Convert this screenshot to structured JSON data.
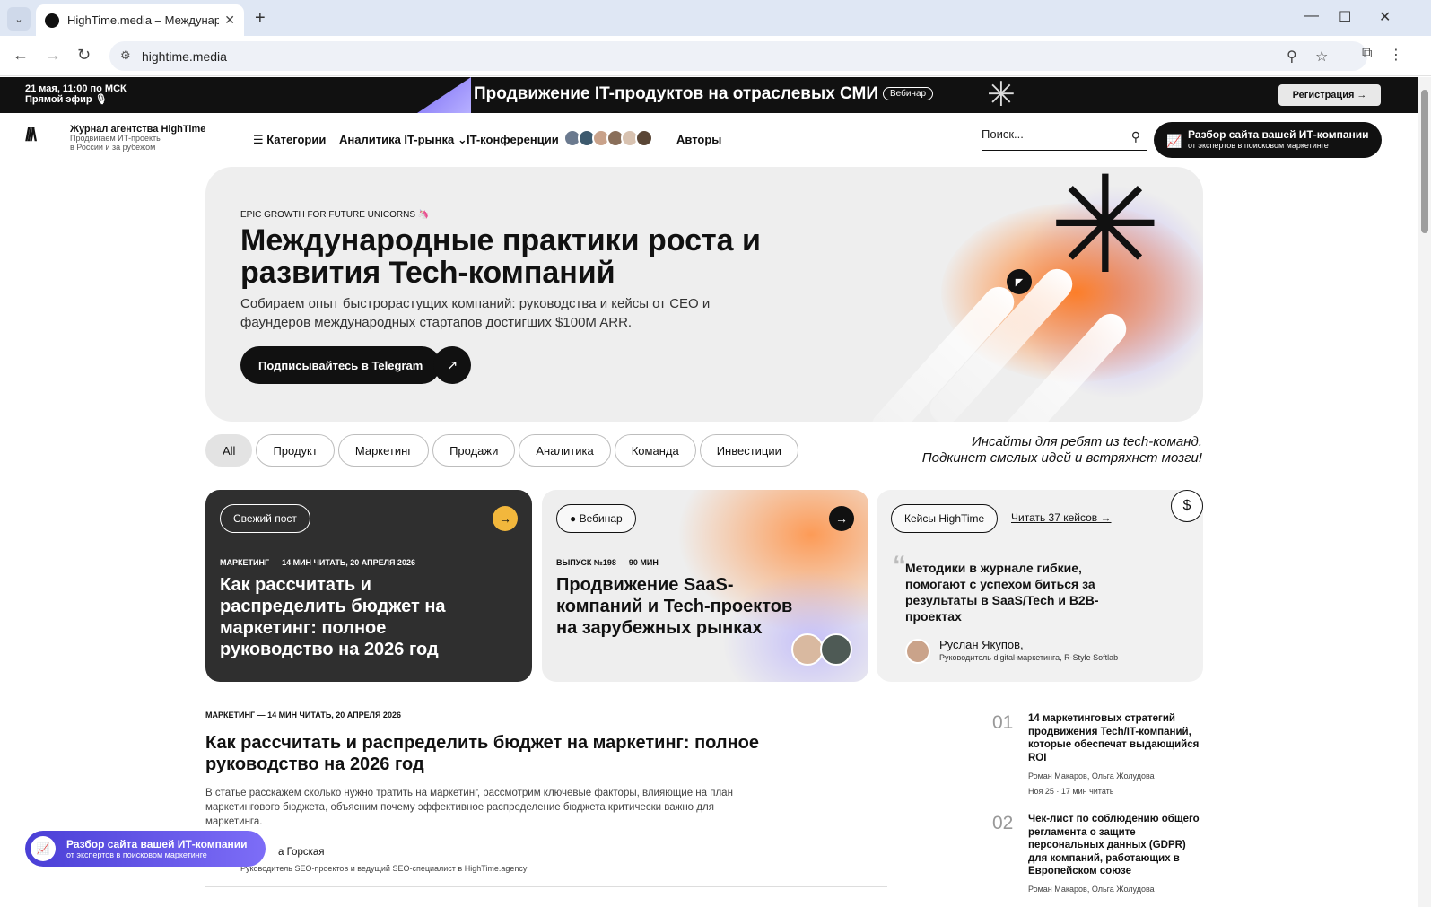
{
  "browser": {
    "tab_title": "HighTime.media – Междунаро",
    "tab_close": "✕",
    "new_tab": "+",
    "url": "hightime.media",
    "window_minimize": "—",
    "window_maximize": "☐",
    "window_close": "✕"
  },
  "promo_bar": {
    "date": "21 мая, 11:00 по МСК",
    "status": "Прямой эфир 🎙",
    "title": "Продвижение IT-продуктов на отраслевых СМИ",
    "badge": "Вебинар",
    "button": "Регистрация →"
  },
  "header": {
    "brand_title": "Журнал агентства HighTime",
    "brand_sub1": "Продвигаем ИТ-проекты",
    "brand_sub2": "в России и за рубежом",
    "menu": [
      "Категории",
      "Аналитика IT-рынка ⌄",
      "IT-конференции ⌄",
      "Авторы"
    ],
    "search_placeholder": "Поиск...",
    "cta_title": "Разбор сайта вашей ИТ-компании",
    "cta_sub": "от экспертов в поисковом маркетинге"
  },
  "hero": {
    "kicker": "EPIC GROWTH FOR FUTURE UNICORNS 🦄",
    "title": "Международные практики роста и развития Tech-компаний",
    "lead": "Собираем опыт быстрорастущих компаний: руководства и кейсы от CEO и фаундеров международных стартапов достигших $100M ARR.",
    "button": "Подписывайтесь в Telegram"
  },
  "filters": {
    "chips": [
      "All",
      "Продукт",
      "Маркетинг",
      "Продажи",
      "Аналитика",
      "Команда",
      "Инвестиции"
    ],
    "tagline_1": "Инсайты для ребят из tech-команд.",
    "tagline_2": "Подкинет смелых идей и встряхнет мозги!"
  },
  "cards": [
    {
      "pill": "Свежий пост",
      "meta": "МАРКЕТИНГ — 14 МИН ЧИТАТЬ, 20 АПРЕЛЯ 2026",
      "title": "Как рассчитать и распределить бюджет на маркетинг: полное руководство на 2026 год"
    },
    {
      "pill": "● Вебинар",
      "meta": "ВЫПУСК №198 — 90 МИН",
      "title": "Продвижение SaaS-компаний и Tech-проектов на зарубежных рынках"
    },
    {
      "pill": "Кейсы HighTime",
      "link": "Читать 37 кейсов →",
      "quote": "Методики в журнале гибкие, помогают с успехом биться за результаты в SaaS/Tech и B2B-проектах",
      "author": "Руслан Якупов,",
      "role": "Руководитель digital-маркетинга, R-Style Softlab"
    }
  ],
  "article": {
    "meta": "МАРКЕТИНГ — 14 МИН ЧИТАТЬ, 20 АПРЕЛЯ 2026",
    "title": "Как рассчитать и распределить бюджет на маркетинг: полное руководство на 2026 год",
    "excerpt": "В статье расскажем сколько нужно тратить на маркетинг, рассмотрим ключевые факторы, влияющие на план маркетингового бюджета, объясним почему эффективное распределение бюджета критически важно для маркетинга.",
    "author": "а Горская",
    "role": "Руководитель SEO-проектов и ведущий SEO-специалист в HighTime.agency"
  },
  "sidebar": [
    {
      "num": "01",
      "title": "14 маркетинговых стратегий продвижения Tech/IT-компаний, которые обеспечат выдающийся ROI",
      "authors": "Роман Макаров, Ольга Жолудова",
      "date": "Ноя 25  · 17 мин читать"
    },
    {
      "num": "02",
      "title": "Чек-лист по соблюдению общего регламента о защите персональных данных (GDPR) для компаний, работающих в Европейском союзе",
      "authors": "Роман Макаров, Ольга Жолудова",
      "date": ""
    }
  ],
  "floater": {
    "title": "Разбор сайта вашей ИТ-компании",
    "sub": "от экспертов в поисковом маркетинге"
  }
}
